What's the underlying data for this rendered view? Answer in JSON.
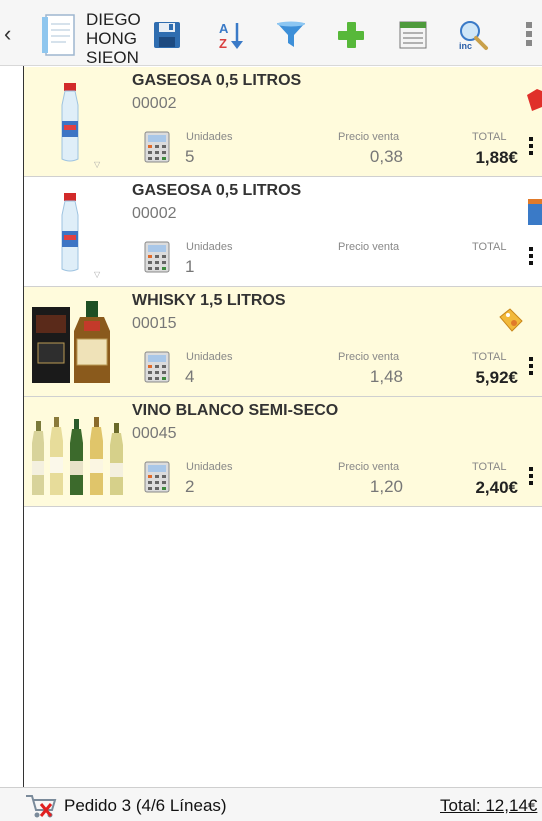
{
  "header": {
    "back_glyph": "‹",
    "customer_lines": [
      "DIEGO",
      "HONG",
      "SIEON"
    ],
    "toolbar_icons": [
      "document-icon",
      "save-icon",
      "sort-az-icon",
      "filter-icon",
      "add-icon",
      "form-icon",
      "search-inc-icon",
      "overflow-menu-icon"
    ]
  },
  "items": [
    {
      "name": "GASEOSA 0,5 LITROS",
      "code": "00002",
      "units_label": "Unidades",
      "units": "5",
      "price_label": "Precio venta",
      "price": "0,38",
      "total_label": "TOTAL",
      "total": "1,88€",
      "image": "water-bottle",
      "selected": true,
      "tag": "red-tag"
    },
    {
      "name": "GASEOSA 0,5 LITROS",
      "code": "00002",
      "units_label": "Unidades",
      "units": "1",
      "price_label": "Precio venta",
      "price": "",
      "total_label": "TOTAL",
      "total": "",
      "image": "water-bottle",
      "selected": false,
      "tag": "blue-box"
    },
    {
      "name": "WHISKY 1,5 LITROS",
      "code": "00015",
      "units_label": "Unidades",
      "units": "4",
      "price_label": "Precio venta",
      "price": "1,48",
      "total_label": "TOTAL",
      "total": "5,92€",
      "image": "whisky",
      "selected": true,
      "tag": "yellow-tag"
    },
    {
      "name": "VINO BLANCO SEMI-SECO",
      "code": "00045",
      "units_label": "Unidades",
      "units": "2",
      "price_label": "Precio venta",
      "price": "1,20",
      "total_label": "TOTAL",
      "total": "2,40€",
      "image": "wine-bottles",
      "selected": true,
      "tag": ""
    }
  ],
  "footer": {
    "order_text": "Pedido 3 (4/6 Líneas)",
    "total_text": "Total: 12,14€"
  },
  "colors": {
    "selected_row": "#fffbdc",
    "save_blue": "#2f6db0",
    "add_green": "#57b83a",
    "filter_blue": "#3d8fd8"
  }
}
